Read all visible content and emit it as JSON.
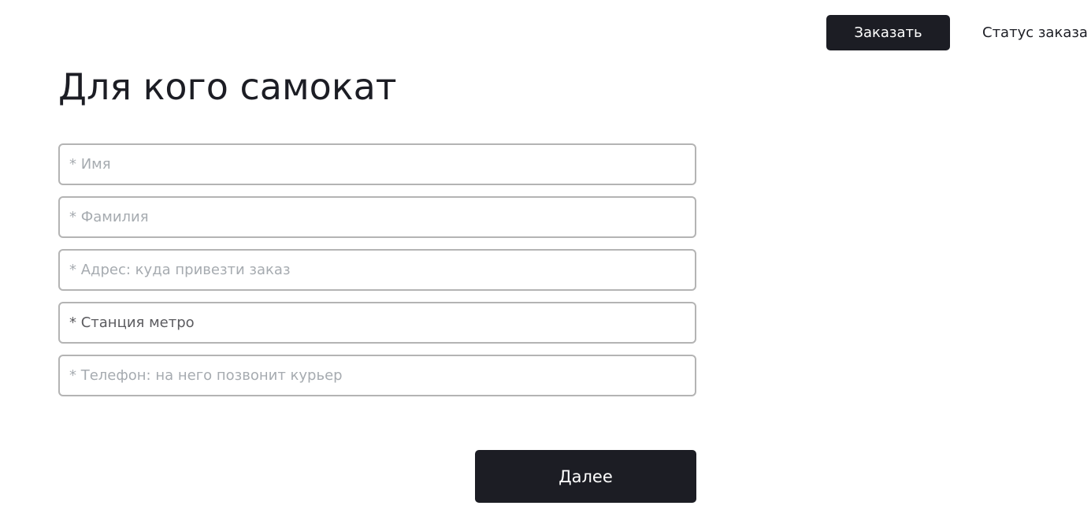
{
  "header": {
    "order_button_label": "Заказать",
    "status_link_label": "Статус заказа"
  },
  "form": {
    "title": "Для кого самокат",
    "fields": [
      {
        "name": "first-name",
        "placeholder": "* Имя",
        "value": ""
      },
      {
        "name": "last-name",
        "placeholder": "* Фамилия",
        "value": ""
      },
      {
        "name": "address",
        "placeholder": "* Адрес: куда привезти заказ",
        "value": ""
      },
      {
        "name": "metro-station",
        "placeholder": "* Станция метро",
        "value": ""
      },
      {
        "name": "phone",
        "placeholder": "* Телефон: на него позвонит курьер",
        "value": ""
      }
    ],
    "next_button_label": "Далее"
  }
}
